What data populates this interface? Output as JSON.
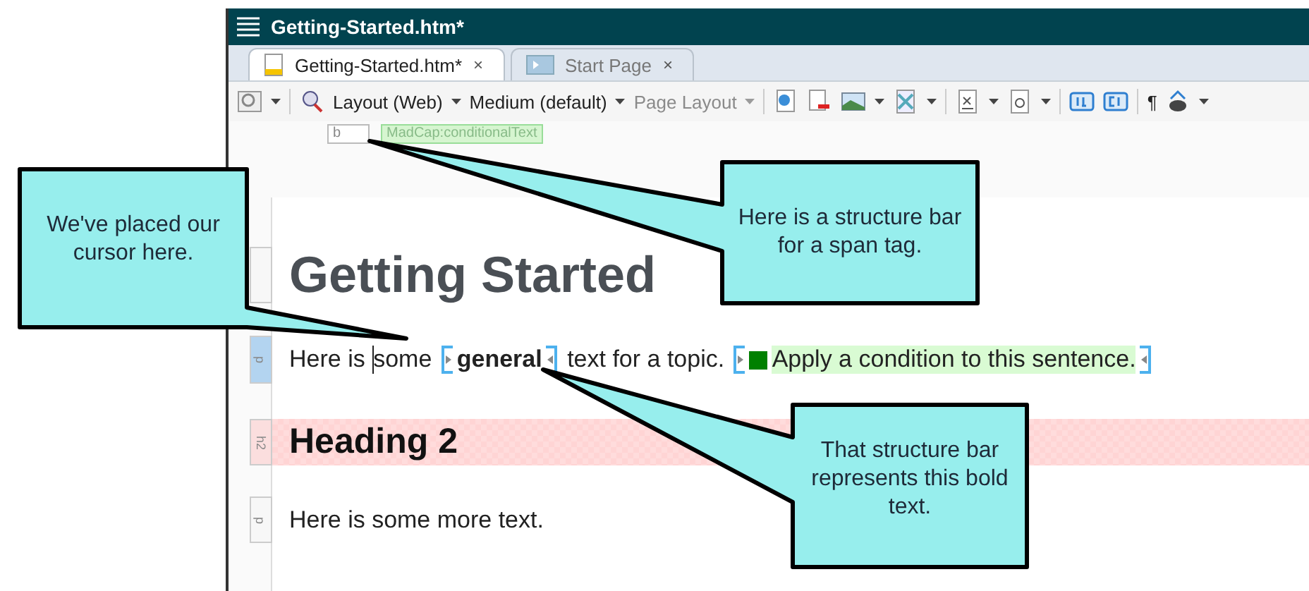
{
  "window": {
    "title": "Getting-Started.htm*"
  },
  "tabs": [
    {
      "label": "Getting-Started.htm*",
      "selected": true,
      "close": "×"
    },
    {
      "label": "Start Page",
      "selected": false,
      "close": "×"
    }
  ],
  "toolbar": [
    {
      "label": "Layout (Web)",
      "disabled": false
    },
    {
      "label": "Medium (default)",
      "disabled": false
    },
    {
      "label": "Page Layout",
      "disabled": true
    }
  ],
  "pilcrow": "¶",
  "structure_tags": [
    {
      "label": "b",
      "kind": "span"
    },
    {
      "label": "MadCap:conditionalText",
      "kind": "condition"
    }
  ],
  "structure_bars": [
    {
      "kind": "h1",
      "selected": false
    },
    {
      "kind": "p",
      "label": "p",
      "selected": true
    },
    {
      "kind": "h2",
      "label": "h2",
      "selected": false
    },
    {
      "kind": "p",
      "label": "p",
      "selected": false
    }
  ],
  "document": {
    "heading": "Getting Started",
    "paragraph": {
      "before_cursor": "Here is",
      "after_cursor": "some",
      "bold": "general",
      "after_bold": "text for a topic.",
      "conditional": {
        "text": "Apply a condition to this sentence.",
        "color": "#008000"
      }
    },
    "heading2": "Heading 2",
    "paragraph2": "Here is some more text."
  },
  "callouts": [
    {
      "text": "We've placed our cursor here."
    },
    {
      "text": "Here is a structure bar for a span tag."
    },
    {
      "text": "That structure bar represents this bold text."
    }
  ]
}
